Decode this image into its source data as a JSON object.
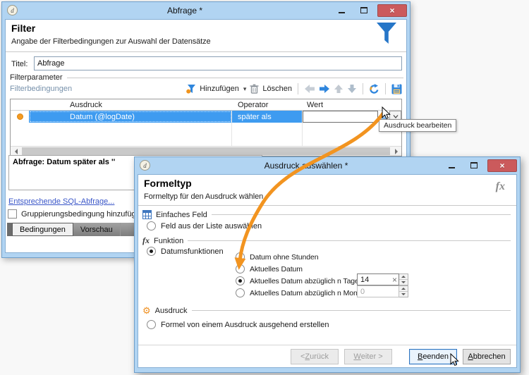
{
  "colors": {
    "titlebar_blue": "#b1d4f2",
    "selection_blue": "#3e9bf0",
    "accent_orange": "#f29420",
    "close_button_red": "#cb5a5c",
    "link_blue": "#3a56c8"
  },
  "icons": {
    "close": "×",
    "caret_down": "▾",
    "fx": "fx",
    "gear": "⚙",
    "app_logo": "d"
  },
  "query_window": {
    "title": "Abfrage *",
    "header": {
      "title": "Filter",
      "subtitle": "Angabe der Filterbedingungen zur Auswahl der Datensätze"
    },
    "title_field": {
      "label": "Titel:",
      "value": "Abfrage"
    },
    "filter_params_label": "Filterparameter",
    "toolbar": {
      "conditions_label": "Filterbedingungen",
      "add": "Hinzufügen",
      "delete": "Löschen"
    },
    "table": {
      "columns": {
        "expression": "Ausdruck",
        "operator": "Operator",
        "value": "Wert"
      },
      "row": {
        "expression": "Datum (@logDate)",
        "operator": "später als",
        "value": ""
      }
    },
    "tooltip": "Ausdruck bearbeiten",
    "summary": "Abfrage: Datum später als ''",
    "sql_link": "Entsprechende SQL-Abfrage...",
    "grouping_checkbox_label": "Gruppierungsbedingung hinzufügen",
    "tabs": {
      "conditions": "Bedingungen",
      "preview": "Vorschau"
    }
  },
  "expression_window": {
    "title": "Ausdruck auswählen *",
    "header": {
      "title": "Formeltyp",
      "subtitle": "Formeltyp für den Ausdruck wählen",
      "fx_badge": "fx"
    },
    "simple_field_group": {
      "label": "Einfaches Feld",
      "radio_field_from_list": "Feld aus der Liste auswählen"
    },
    "function_group": {
      "label": "Funktion",
      "radio_date_functions": "Datumsfunktionen",
      "radio_date_without_hours": "Datum ohne Stunden",
      "radio_current_date": "Aktuelles Datum",
      "radio_current_date_minus_days": "Aktuelles Datum abzüglich n Tage",
      "days_value": "14",
      "radio_current_date_minus_months": "Aktuelles Datum abzüglich n Monate",
      "months_value": "0"
    },
    "expression_group": {
      "label": "Ausdruck",
      "radio_formula_from_expression": "Formel von einem Ausdruck ausgehend erstellen"
    },
    "buttons": {
      "back": "< Zurück",
      "next": "Weiter >",
      "finish": "Beenden",
      "cancel": "Abbrechen"
    }
  }
}
